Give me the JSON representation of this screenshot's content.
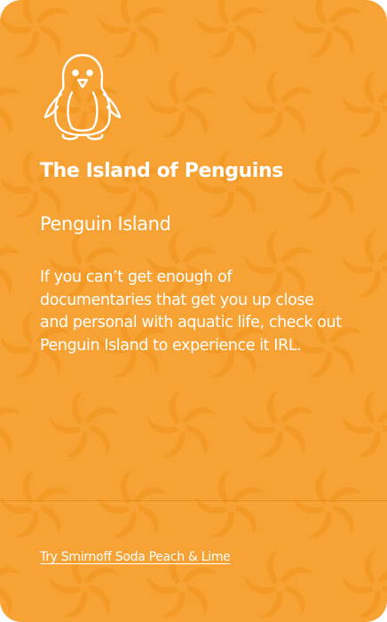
{
  "card": {
    "icon": "penguin-icon",
    "title": "The Island of Penguins",
    "subtitle": "Penguin Island",
    "body": "If you can’t get enough of documentaries that get you up close and personal with aquatic life, check out Penguin Island to experience it IRL.",
    "cta_label": "Try Smirnoff Soda Peach & Lime"
  },
  "colors": {
    "background": "#f7a234",
    "pattern": "#f39a22",
    "text": "#ffffff"
  }
}
